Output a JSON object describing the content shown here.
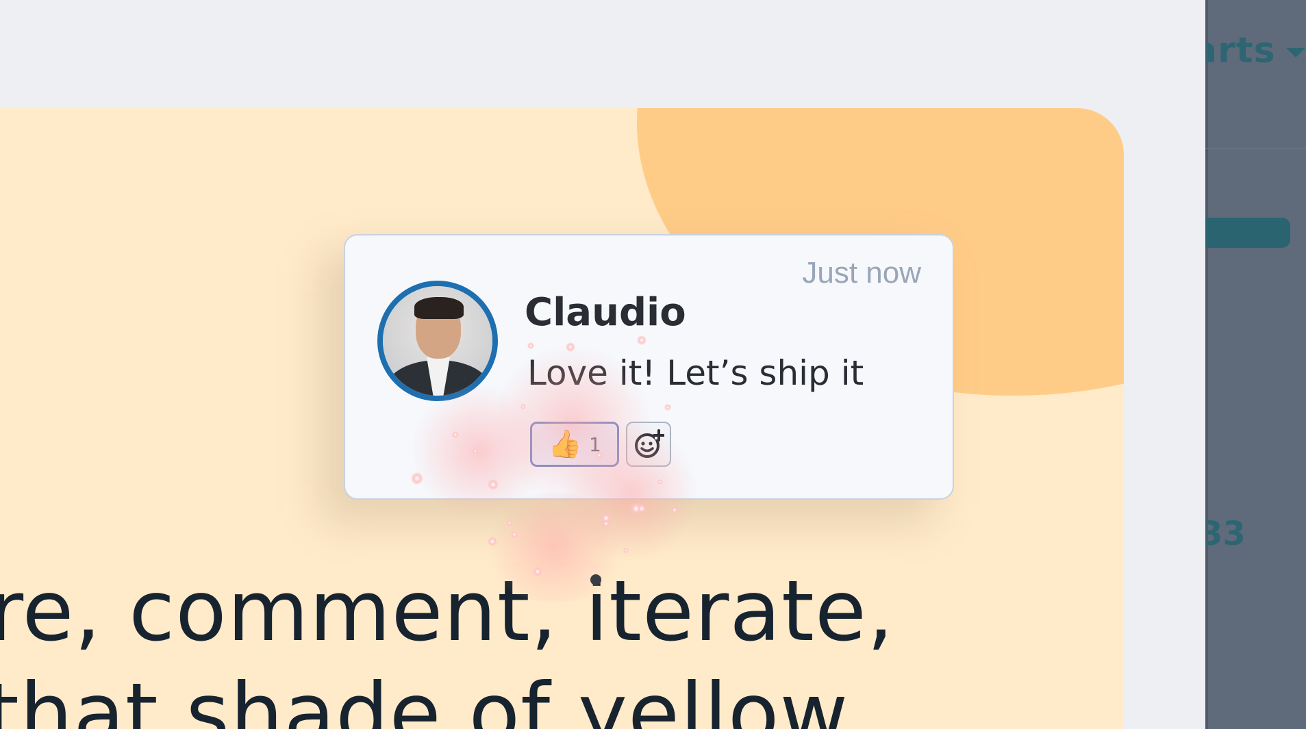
{
  "sidebar": {
    "menu_label": "arts",
    "value": "33"
  },
  "slide": {
    "headline_line1": "re, comment, iterate,",
    "headline_line2": "that shade of yellow"
  },
  "comment": {
    "timestamp": "Just now",
    "author": "Claudio",
    "message": "Love it! Let’s ship it",
    "reactions": [
      {
        "emoji": "👍",
        "count": "1"
      }
    ]
  },
  "colors": {
    "slide_bg": "#ffeac9",
    "blob": "#ffcc88",
    "avatar_ring": "#1d6fb0",
    "reaction_border": "#6d87c4"
  }
}
